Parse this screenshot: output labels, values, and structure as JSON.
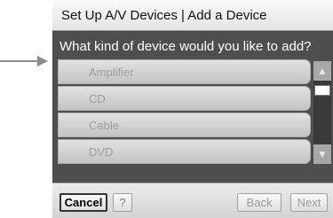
{
  "dialog": {
    "title": "Set Up A/V Devices | Add a Device",
    "question": "What kind of device would you like to add?"
  },
  "devices": [
    "Amplifier",
    "CD",
    "Cable",
    "DVD"
  ],
  "scrollbar": {
    "up_glyph": "▲",
    "down_glyph": "▼"
  },
  "footer": {
    "cancel_label": "Cancel",
    "help_label": "?",
    "back_label": "Back",
    "next_label": "Next"
  }
}
